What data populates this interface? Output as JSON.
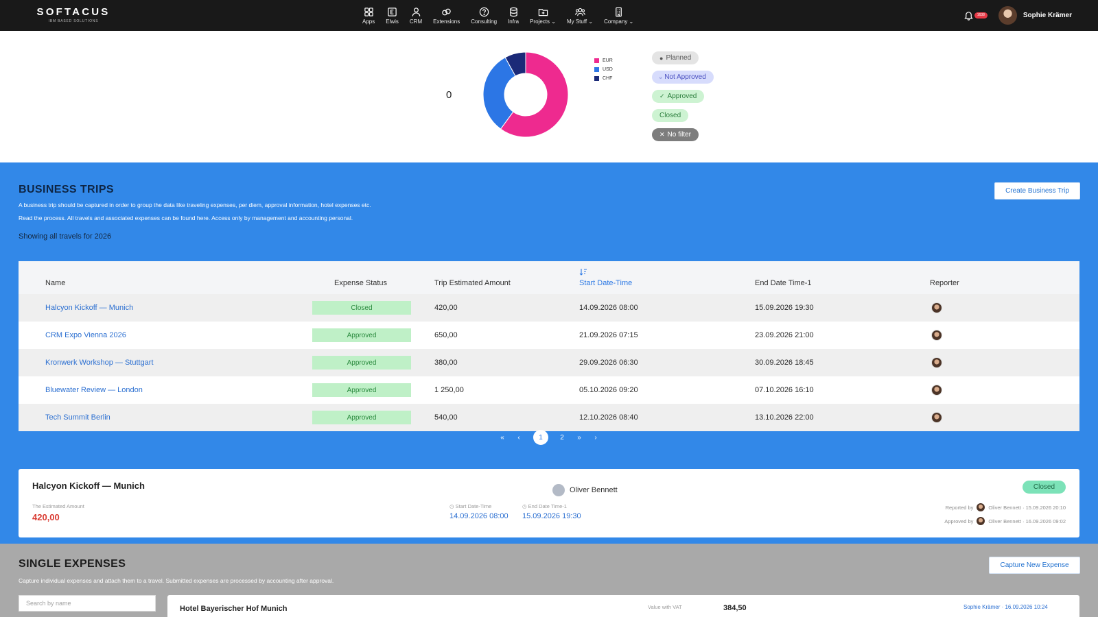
{
  "brand": {
    "name": "SOFTACUS",
    "tagline": "IBM BASED SOLUTIONS"
  },
  "nav": {
    "items": [
      {
        "label": "Apps",
        "icon": "grid-icon"
      },
      {
        "label": "Elwis",
        "icon": "elwis-icon"
      },
      {
        "label": "CRM",
        "icon": "person-icon"
      },
      {
        "label": "Extensions",
        "icon": "link-icon"
      },
      {
        "label": "Consulting",
        "icon": "help-icon"
      },
      {
        "label": "Infra",
        "icon": "database-icon"
      },
      {
        "label": "Projects",
        "icon": "folder-icon"
      },
      {
        "label": "My Stuff",
        "icon": "users-icon"
      },
      {
        "label": "Company",
        "icon": "building-icon"
      }
    ],
    "notifications": "1638",
    "user_name": "Sophie Krämer"
  },
  "summary": {
    "count": "0",
    "legend": [
      {
        "label": "EUR",
        "color": "#ee2a8f"
      },
      {
        "label": "USD",
        "color": "#2c76e5"
      },
      {
        "label": "CHF",
        "color": "#1b2a78"
      }
    ],
    "donut_shares": [
      0.6,
      0.32,
      0.08
    ],
    "filters": [
      {
        "label": "Planned",
        "icon": "dot-icon"
      },
      {
        "label": "Not Approved",
        "icon": "square-icon"
      },
      {
        "label": "Approved",
        "icon": "check-icon"
      },
      {
        "label": "Closed",
        "icon": ""
      },
      {
        "label": "No filter",
        "icon": "close-icon"
      }
    ]
  },
  "trips": {
    "title": "BUSINESS TRIPS",
    "desc1": "A business trip should be captured in order to group the data like traveling expenses, per diem, approval information, hotel expenses etc.",
    "desc2": "Read the process. All travels and associated expenses can be found here. Access only by management and accounting personal.",
    "showing": "Showing all travels for 2026",
    "create_label": "Create Business Trip",
    "columns": {
      "name": "Name",
      "status": "Expense Status",
      "amount": "Trip Estimated Amount",
      "start": "Start Date-Time",
      "end": "End Date Time-1",
      "reporter": "Reporter"
    },
    "rows": [
      {
        "name": "Halcyon Kickoff — Munich",
        "status": "Closed",
        "amount": "420,00",
        "start": "14.09.2026 08:00",
        "end": "15.09.2026 19:30"
      },
      {
        "name": "CRM Expo Vienna 2026",
        "status": "Approved",
        "amount": "650,00",
        "start": "21.09.2026 07:15",
        "end": "23.09.2026 21:00"
      },
      {
        "name": "Kronwerk Workshop — Stuttgart",
        "status": "Approved",
        "amount": "380,00",
        "start": "29.09.2026 06:30",
        "end": "30.09.2026 18:45"
      },
      {
        "name": "Bluewater Review — London",
        "status": "Approved",
        "amount": "1 250,00",
        "start": "05.10.2026 09:20",
        "end": "07.10.2026 16:10"
      },
      {
        "name": "Tech Summit Berlin",
        "status": "Approved",
        "amount": "540,00",
        "start": "12.10.2026 08:40",
        "end": "13.10.2026 22:00"
      }
    ],
    "pagination": {
      "first": "«",
      "prev": "‹",
      "pages": [
        "1",
        "2"
      ],
      "next_group": "»",
      "next": "›"
    },
    "detail": {
      "title": "Halcyon Kickoff — Munich",
      "amount_label": "The Estimated Amount",
      "amount": "420,00",
      "person": "Oliver Bennett",
      "start_label": "Start Date-Time",
      "start": "14.09.2026 08:00",
      "end_label": "End Date Time-1",
      "end": "15.09.2026 19:30",
      "status": "Closed",
      "reported_by_label": "Reported by",
      "reported_by": "Oliver Bennett · 15.09.2026 20:10",
      "approved_by_label": "Approved by",
      "approved_by": "Oliver Bennett · 16.09.2026 09:02"
    }
  },
  "expenses": {
    "title": "SINGLE EXPENSES",
    "desc": "Capture individual expenses and attach them to a travel. Submitted expenses are processed by accounting after approval.",
    "capture_label": "Capture New Expense",
    "search_placeholder": "Search by name",
    "first": {
      "name": "Hotel Bayerischer Hof Munich",
      "vat_label": "Value with VAT",
      "vat": "384,50",
      "meta": "Sophie Krämer · 16.09.2026 10:24"
    }
  }
}
